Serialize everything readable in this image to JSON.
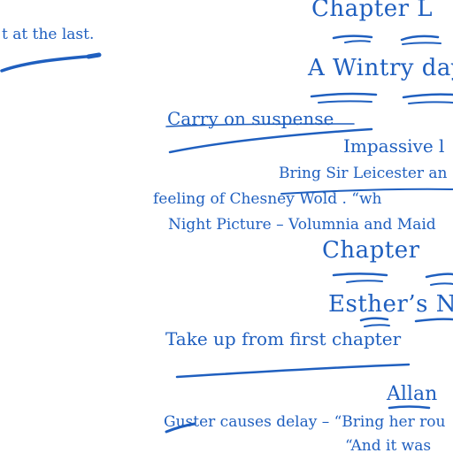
{
  "page": {
    "ink_color": "#1f5fbf",
    "background": "#ffffff"
  },
  "lines": {
    "chapter_l": "Chapter L",
    "last_line": "t at the last.",
    "wintry_day": "A Wintry day",
    "carry_on": "Carry on suspense",
    "impassive": "Impassive l",
    "bring_sir": "Bring Sir Leicester an",
    "chesney": "feeling of Chesney Wold .          “wh",
    "night_picture": "Night Picture – Volumnia and Maid",
    "chapter2": "Chapter",
    "esthers": "Esther’s Na",
    "take_up": "Take up from first chapter",
    "allan": "Allan",
    "guster": "Guster causes delay – “Bring her rou",
    "and_it_was": "“And it was"
  }
}
